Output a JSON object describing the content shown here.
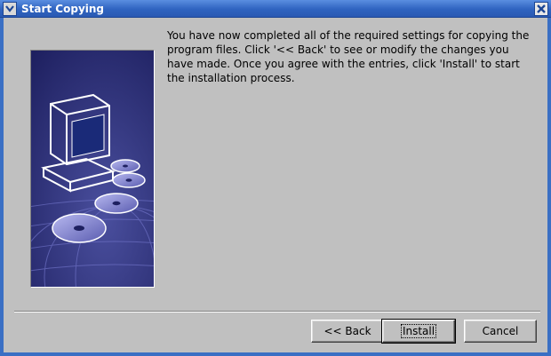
{
  "window": {
    "title": "Start Copying",
    "colors": {
      "title_bar": "#2f63c0",
      "frame": "#3a6fc4",
      "background": "#c0c0c0"
    }
  },
  "message": "You have now completed all of the required settings for copying the program files. Click '<< Back' to see or modify the changes you have made. Once you agree with the entries, click 'Install' to start the installation process.",
  "buttons": {
    "back": "<< Back",
    "install": "Install",
    "cancel": "Cancel"
  },
  "graphic": {
    "icon": "computer-with-discs-illustration",
    "colors": {
      "background": "#2a2c6e",
      "accent": "#8c8fd8"
    }
  }
}
